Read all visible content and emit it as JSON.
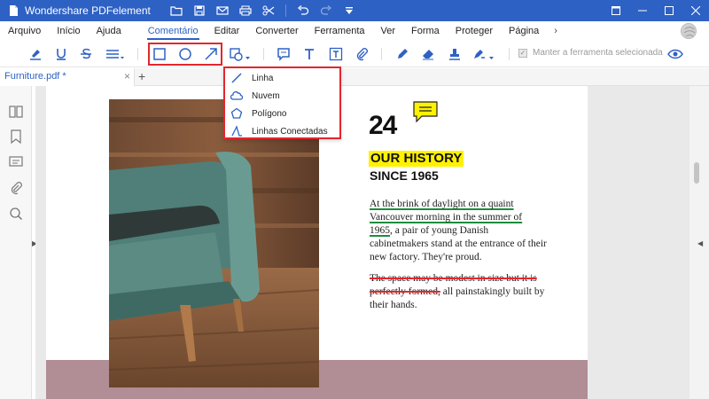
{
  "app": {
    "title": "Wondershare PDFelement"
  },
  "menu": {
    "items": [
      {
        "label": "Arquivo"
      },
      {
        "label": "Início"
      },
      {
        "label": "Ajuda"
      },
      {
        "label": "Comentário",
        "active": true
      },
      {
        "label": "Editar"
      },
      {
        "label": "Converter"
      },
      {
        "label": "Ferramenta"
      },
      {
        "label": "Ver"
      },
      {
        "label": "Forma"
      },
      {
        "label": "Proteger"
      },
      {
        "label": "Página"
      }
    ],
    "more": "›"
  },
  "toolbar": {
    "keep_tool_label": "Manter a ferramenta selecionada",
    "keep_tool_checked": true
  },
  "tabs": {
    "document": "Furniture.pdf *",
    "close": "×",
    "add": "+"
  },
  "dropdown": {
    "items": [
      {
        "label": "Linha",
        "icon": "line-icon"
      },
      {
        "label": "Nuvem",
        "icon": "cloud-icon"
      },
      {
        "label": "Polígono",
        "icon": "polygon-icon"
      },
      {
        "label": "Linhas Conectadas",
        "icon": "connected-lines-icon"
      }
    ]
  },
  "document": {
    "big_number": "24",
    "heading1": "OUR HISTORY",
    "heading2": "SINCE 1965",
    "para1_underlined": "At the brink of daylight on a quaint Vancouver morning in the summer of 1965",
    "para1_rest": ", a pair of young Danish cabinetmakers stand at the entrance of their new factory. They're proud.",
    "para2_struck": "The space may be modest in size but it is perfectly formed,",
    "para2_rest": " all painstakingly built by their hands."
  },
  "colors": {
    "brand_blue": "#2e61c4",
    "highlight_red": "#e3262d",
    "highlight_yellow": "#fff200",
    "underline_green": "#1e8c3c",
    "footer_band": "#b18d95"
  }
}
